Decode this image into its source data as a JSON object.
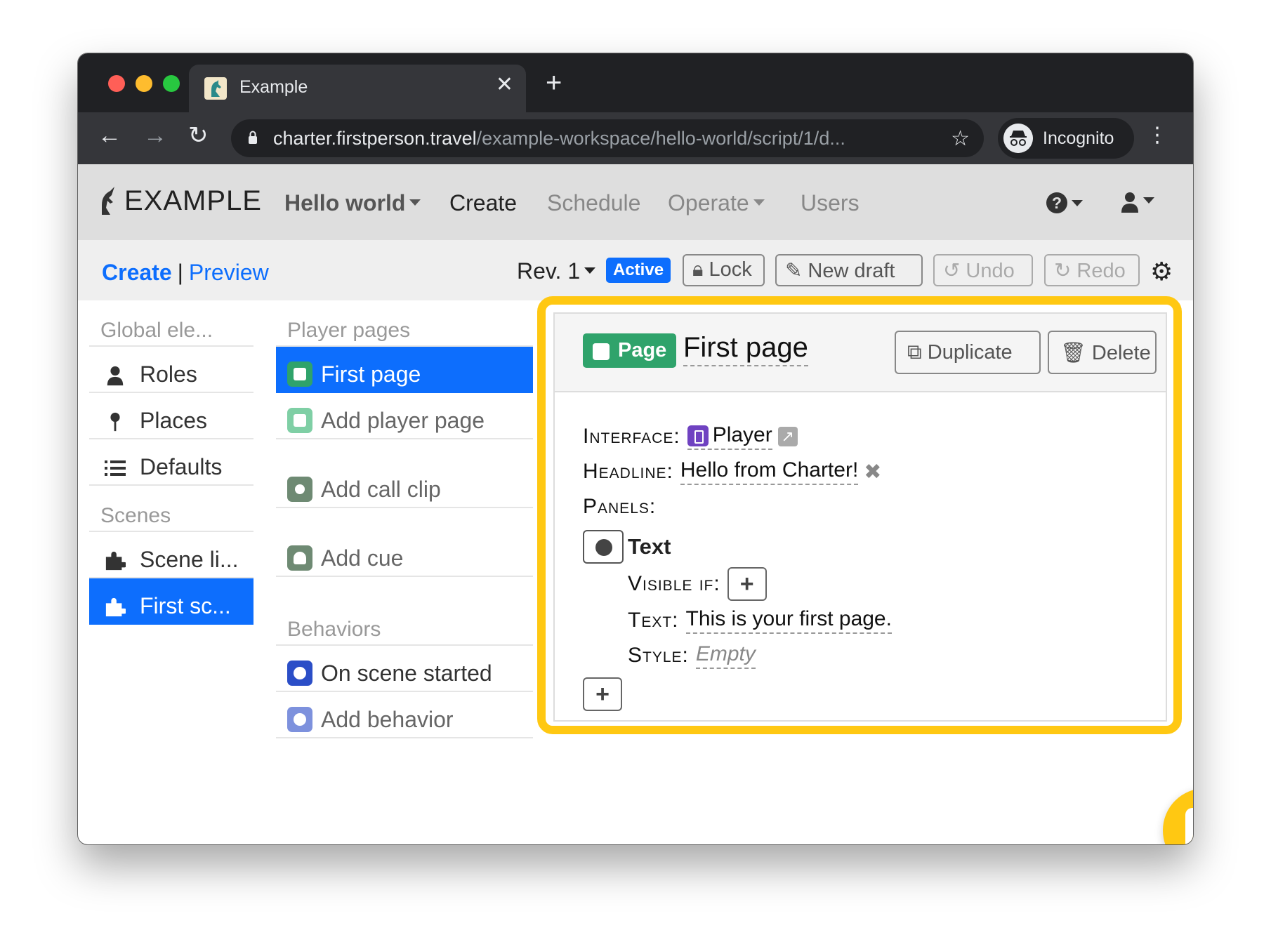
{
  "browser": {
    "tab_title": "Example",
    "tab_close": "✕",
    "new_tab": "+",
    "url_host": "charter.firstperson.travel",
    "url_path": "/example-workspace/hello-world/script/1/d...",
    "incognito_label": "Incognito",
    "icons": {
      "back": "arrow-left-icon",
      "forward": "arrow-right-icon",
      "reload": "reload-icon",
      "lock": "lock-icon",
      "bookmark": "star-icon",
      "menu": "kebab-menu-icon"
    }
  },
  "navbar": {
    "brand": "EXAMPLE",
    "workspace": "Hello world",
    "items": {
      "create": "Create",
      "schedule": "Schedule",
      "operate": "Operate",
      "users": "Users"
    },
    "help_icon": "?"
  },
  "subheader": {
    "create": "Create",
    "separator": "|",
    "preview": "Preview",
    "revision": "Rev. 1",
    "status_badge": "Active",
    "buttons": {
      "lock": "Lock",
      "new_draft": "New draft",
      "undo": "Undo",
      "redo": "Redo"
    }
  },
  "sidebar": {
    "global_heading": "Global ele...",
    "items": [
      {
        "label": "Roles",
        "icon": "user-icon"
      },
      {
        "label": "Places",
        "icon": "pin-icon"
      },
      {
        "label": "Defaults",
        "icon": "list-icon"
      }
    ],
    "scenes_heading": "Scenes",
    "scenes": [
      {
        "label": "Scene li...",
        "icon": "puzzle-icon"
      },
      {
        "label": "First sc...",
        "icon": "puzzle-icon",
        "active": true
      }
    ]
  },
  "middle": {
    "player_pages_heading": "Player pages",
    "first_page": "First page",
    "add_player_page": "Add player page",
    "add_call_clip": "Add call clip",
    "add_cue": "Add cue",
    "behaviors_heading": "Behaviors",
    "on_scene_started": "On scene started",
    "add_behavior": "Add behavior"
  },
  "detail": {
    "badge": "Page",
    "title": "First page",
    "duplicate": "Duplicate",
    "delete": "Delete",
    "interface_label": "Interface:",
    "interface_value": "Player",
    "headline_label": "Headline:",
    "headline_value": "Hello from Charter!",
    "panels_label": "Panels:",
    "panel_type": "Text",
    "visible_if_label": "Visible if:",
    "text_label": "Text:",
    "text_value": "This is your first page.",
    "style_label": "Style:",
    "style_value": "Empty",
    "plus": "+"
  },
  "colors": {
    "accent": "#0d6efd",
    "highlight": "#ffc812",
    "page_green": "#2fa36b",
    "behavior_blue": "#2b4ec7",
    "interface_purple": "#6f42c1"
  }
}
